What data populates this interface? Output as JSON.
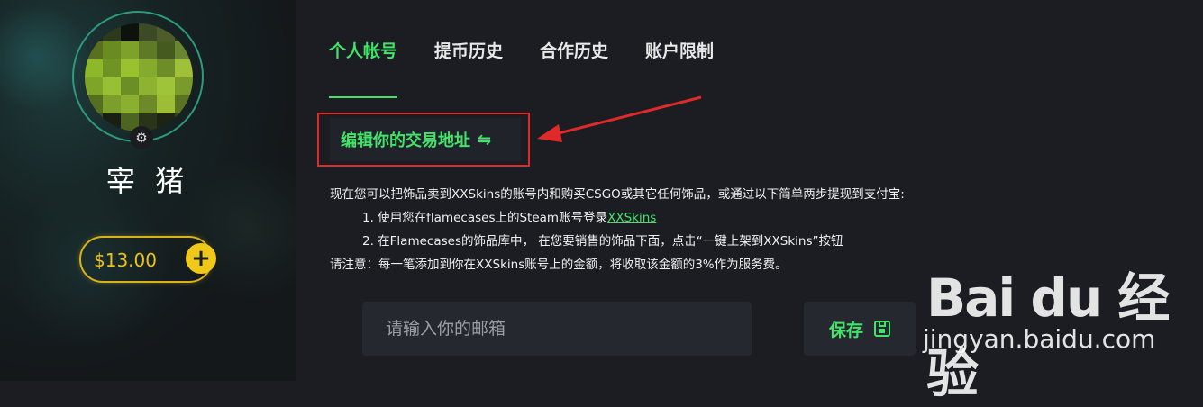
{
  "profile": {
    "username": "宰 猪",
    "balance": "$13.00",
    "add_label": "+"
  },
  "tabs": [
    {
      "label": "个人帐号",
      "active": true
    },
    {
      "label": "提币历史",
      "active": false
    },
    {
      "label": "合作历史",
      "active": false
    },
    {
      "label": "账户限制",
      "active": false
    }
  ],
  "edit_trade": {
    "label": "编辑你的交易地址",
    "icon": "swap-icon"
  },
  "info": {
    "line1": "现在您可以把饰品卖到XXSkins的账号内和购买CSGO或其它任何饰品，或通过以下简单两步提现到支付宝:",
    "step1_prefix": "1. 使用您在flamecases上的Steam账号登录",
    "step1_link": "XXSkins",
    "step2": "2. 在Flamecases的饰品库中， 在您要销售的饰品下面，点击“一键上架到XXSkins”按钮",
    "note": "请注意：每一笔添加到你在XXSkins账号上的金额，将收取该金额的3%作为服务费。"
  },
  "email": {
    "placeholder": "请输入你的邮箱",
    "value": ""
  },
  "save": {
    "label": "保存",
    "icon": "save-icon"
  },
  "watermark": {
    "logo": "Bai du 经验",
    "url": "jingyan.baidu.com"
  },
  "colors": {
    "accent": "#43e26a",
    "gold": "#ecc21a",
    "annotation": "#e02a2a"
  }
}
